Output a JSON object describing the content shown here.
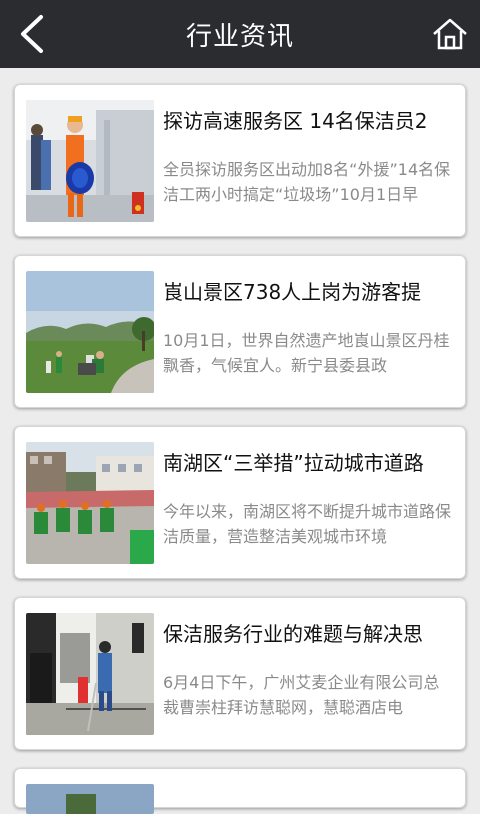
{
  "header": {
    "title": "行业资讯",
    "back_icon": "back-chevron-icon",
    "home_icon": "home-icon"
  },
  "articles": [
    {
      "title": "探访高速服务区 14名保洁员2",
      "summary": "全员探访服务区出动加8名“外援”14名保洁工两小时搞定“垃圾场”10月1日早"
    },
    {
      "title": "崀山景区738人上岗为游客提",
      "summary": "10月1日，世界自然遗产地崀山景区丹桂飘香，气候宜人。新宁县委县政"
    },
    {
      "title": "南湖区“三举措”拉动城市道路",
      "summary": "今年以来，南湖区将不断提升城市道路保洁质量，营造整洁美观城市环境"
    },
    {
      "title": "保洁服务行业的难题与解决思",
      "summary": "6月4日下午，广州艾麦企业有限公司总裁曹崇柱拜访慧聪网，慧聪酒店电"
    }
  ],
  "colors": {
    "topbar": "#2b2c30",
    "background": "#ececec",
    "card": "#ffffff",
    "summary_text": "#8a8a8a"
  }
}
